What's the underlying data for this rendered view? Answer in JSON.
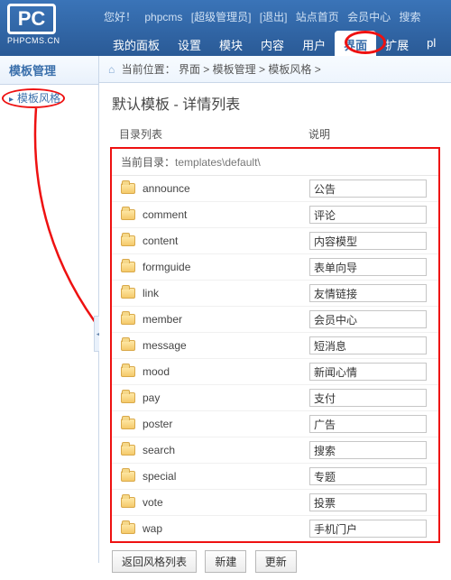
{
  "header": {
    "logo_text": "PC",
    "logo_url": "PHPCMS.CN",
    "greeting": "您好！",
    "username": "phpcms",
    "role": "[超级管理员]",
    "logout": "[退出]",
    "links": [
      "站点首页",
      "会员中心",
      "搜索"
    ]
  },
  "nav": [
    "我的面板",
    "设置",
    "模块",
    "内容",
    "用户",
    "界面",
    "扩展",
    "pl"
  ],
  "nav_active_index": 5,
  "sidebar": {
    "title": "模板管理",
    "items": [
      "模板风格"
    ]
  },
  "breadcrumb": {
    "label": "当前位置：",
    "parts": [
      "界面",
      "模板管理",
      "模板风格"
    ]
  },
  "page_title": "默认模板 - 详情列表",
  "columns": {
    "name": "目录列表",
    "desc": "说明"
  },
  "current_dir_label": "当前目录：",
  "current_dir": "templates\\default\\",
  "rows": [
    {
      "name": "announce",
      "desc": "公告"
    },
    {
      "name": "comment",
      "desc": "评论"
    },
    {
      "name": "content",
      "desc": "内容模型"
    },
    {
      "name": "formguide",
      "desc": "表单向导"
    },
    {
      "name": "link",
      "desc": "友情链接"
    },
    {
      "name": "member",
      "desc": "会员中心"
    },
    {
      "name": "message",
      "desc": "短消息"
    },
    {
      "name": "mood",
      "desc": "新闻心情"
    },
    {
      "name": "pay",
      "desc": "支付"
    },
    {
      "name": "poster",
      "desc": "广告"
    },
    {
      "name": "search",
      "desc": "搜索"
    },
    {
      "name": "special",
      "desc": "专题"
    },
    {
      "name": "vote",
      "desc": "投票"
    },
    {
      "name": "wap",
      "desc": "手机门户"
    }
  ],
  "buttons": {
    "back": "返回风格列表",
    "new": "新建",
    "update": "更新"
  }
}
